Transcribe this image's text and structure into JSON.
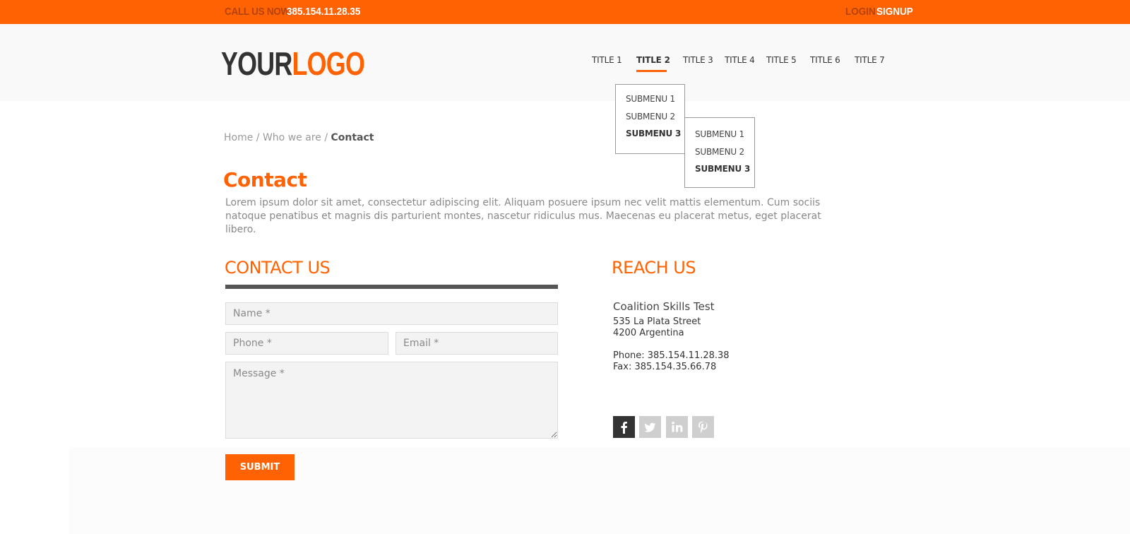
{
  "topbar": {
    "call_label": "CALL US NOW!",
    "phone": "385.154.11.28.35",
    "login": "LOGIN",
    "signup": "SIGNUP"
  },
  "logo": {
    "part1": "YOUR",
    "part2": "LOGO"
  },
  "nav": {
    "items": [
      "TITLE 1",
      "TITLE 2",
      "TITLE 3",
      "TITLE 4",
      "TITLE 5",
      "TITLE 6",
      "TITLE 7"
    ],
    "active": "TITLE 2",
    "submenu_1": [
      "SUBMENU 1",
      "SUBMENU 2",
      "SUBMENU 3"
    ],
    "submenu_2": [
      "SUBMENU 1",
      "SUBMENU 2",
      "SUBMENU 3"
    ]
  },
  "breadcrumb": {
    "home": "Home",
    "sep": "/",
    "who": "Who we are",
    "current": "Contact"
  },
  "page": {
    "title": "Contact",
    "intro": "Lorem ipsum dolor sit amet, consectetur adipiscing elit. Aliquam posuere ipsum nec velit mattis elementum. Cum sociis natoque penatibus et magnis dis parturient montes, nascetur ridiculus mus. Maecenas eu placerat metus, eget placerat libero."
  },
  "contact_form": {
    "heading": "CONTACT US",
    "name_placeholder": "Name *",
    "phone_placeholder": "Phone *",
    "email_placeholder": "Email *",
    "message_placeholder": "Message *",
    "submit_label": "SUBMIT"
  },
  "reach": {
    "heading": "REACH US",
    "company": "Coalition Skills Test",
    "street": "535 La Plata Street",
    "city": "4200 Argentina",
    "phone": "Phone: 385.154.11.28.38",
    "fax": "Fax: 385.154.35.66.78",
    "social": [
      "facebook-icon",
      "twitter-icon",
      "linkedin-icon",
      "pinterest-icon"
    ]
  },
  "colors": {
    "accent": "#ff6203",
    "dark": "#333333",
    "muted": "#999999"
  }
}
